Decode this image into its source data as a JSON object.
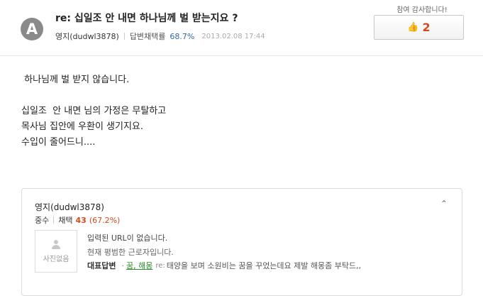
{
  "question": {
    "avatar_letter": "A",
    "title": "re: 십일조 안 내면 하나님께 벌 받는지요 ?",
    "author": "영지(dudwl3878)",
    "adoption_label": "답변채택률",
    "adoption_rate": "68.7%",
    "date": "2013.02.08 17:44"
  },
  "thanks": {
    "label": "참여 감사합니다!",
    "count": "2",
    "icon": "thumbs-up-icon",
    "icon_color": "#e0a020"
  },
  "body": {
    "lines": [
      " 하나님께 벌 받지 않습니다.",
      "",
      "십일조  안 내면 님의 가정은 무탈하고",
      "목사님 집안에 우환이 생기지요.",
      "수입이 줄어드니...."
    ]
  },
  "profile": {
    "name": "영지(dudwl3878)",
    "grade": "중수",
    "adopt_label": "채택",
    "adopt_count": "43",
    "adopt_rate": "(67.2%)",
    "photo_placeholder": "사진없음",
    "url_text": "입력된 URL이 없습니다.",
    "status_text": "현재 평범한 근로자입니다.",
    "rep_label": "대표답변",
    "rep_bullet": "·",
    "rep_tags": "꿈, 해몽",
    "rep_prefix": "re:",
    "rep_title": "태양을 보며 소원비는 꿈을 꾸었는데요 제발 해몽좀 부탁드,,",
    "toggle_icon": "chevron-up-icon"
  },
  "colors": {
    "accent_red": "#d44a1d",
    "link_blue": "#3366aa",
    "tag_green": "#2a8f2a"
  }
}
